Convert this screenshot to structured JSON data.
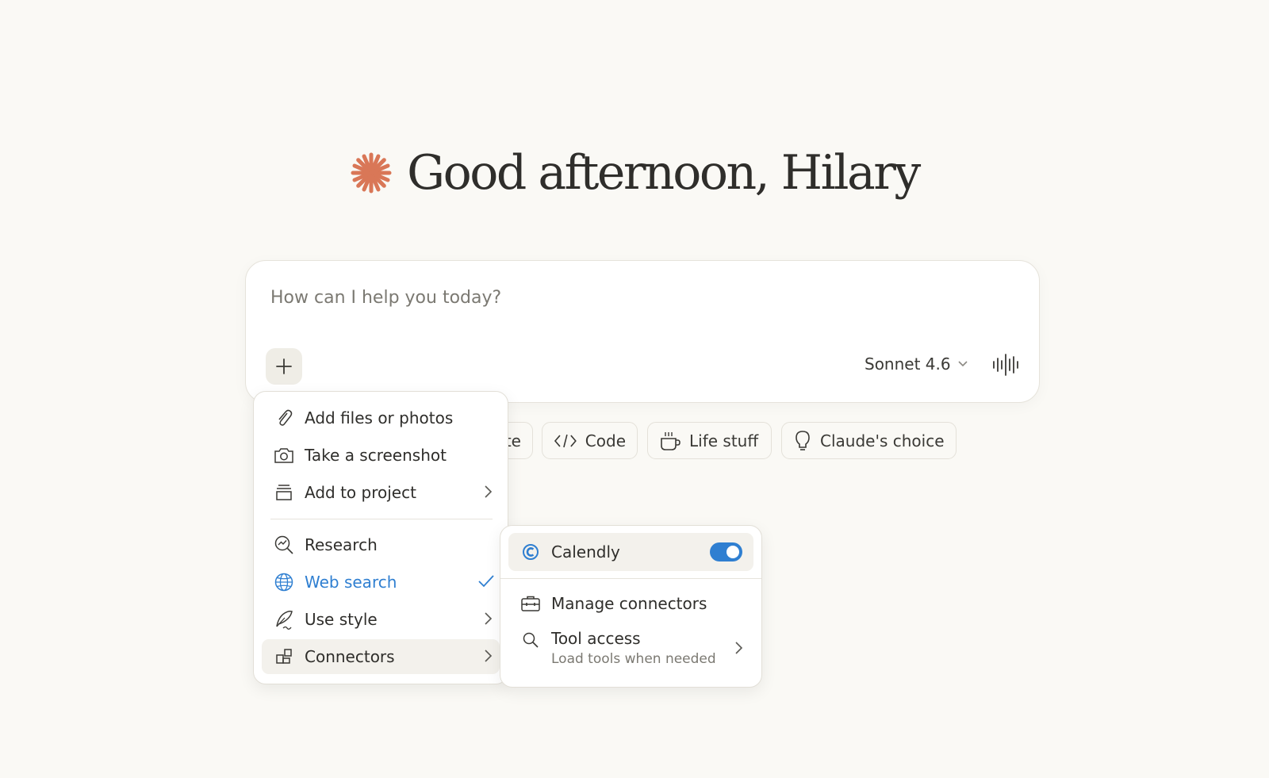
{
  "greeting": {
    "text": "Good afternoon, Hilary"
  },
  "composer": {
    "placeholder": "How can I help you today?",
    "model_label": "Sonnet 4.6"
  },
  "chips": [
    {
      "label": "te"
    },
    {
      "label": "Code"
    },
    {
      "label": "Life stuff"
    },
    {
      "label": "Claude's choice"
    }
  ],
  "menu": {
    "items": [
      {
        "label": "Add files or photos",
        "icon": "paperclip-icon"
      },
      {
        "label": "Take a screenshot",
        "icon": "camera-icon"
      },
      {
        "label": "Add to project",
        "icon": "project-icon"
      },
      {
        "label": "Research",
        "icon": "research-icon"
      },
      {
        "label": "Web search",
        "icon": "globe-icon"
      },
      {
        "label": "Use style",
        "icon": "quill-icon"
      },
      {
        "label": "Connectors",
        "icon": "connectors-icon"
      }
    ]
  },
  "submenu": {
    "calendly_label": "Calendly",
    "calendly_enabled": true,
    "manage_label": "Manage connectors",
    "tool_access_label": "Tool access",
    "tool_access_sub": "Load tools when needed"
  },
  "colors": {
    "background": "#faf9f5",
    "accent_spark": "#d97757",
    "accent_blue": "#2f7fd1"
  }
}
